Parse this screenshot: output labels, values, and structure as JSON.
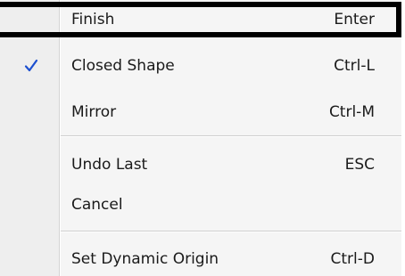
{
  "menu": {
    "items": [
      {
        "label": "Finish",
        "shortcut": "Enter",
        "checked": false,
        "highlighted": true
      },
      {
        "label": "Closed Shape",
        "shortcut": "Ctrl-L",
        "checked": true,
        "highlighted": false
      },
      {
        "label": "Mirror",
        "shortcut": "Ctrl-M",
        "checked": false,
        "highlighted": false
      },
      {
        "label": "Undo Last",
        "shortcut": "ESC",
        "checked": false,
        "highlighted": false
      },
      {
        "label": "Cancel",
        "shortcut": "",
        "checked": false,
        "highlighted": false
      },
      {
        "label": "Set Dynamic Origin",
        "shortcut": "Ctrl-D",
        "checked": false,
        "highlighted": false
      }
    ]
  },
  "colors": {
    "check": "#1c4fcf",
    "highlight_border": "#000000",
    "menu_background": "#f5f5f5",
    "gutter_background": "#eeeeee"
  },
  "icons": {
    "check": "checkmark-icon"
  }
}
